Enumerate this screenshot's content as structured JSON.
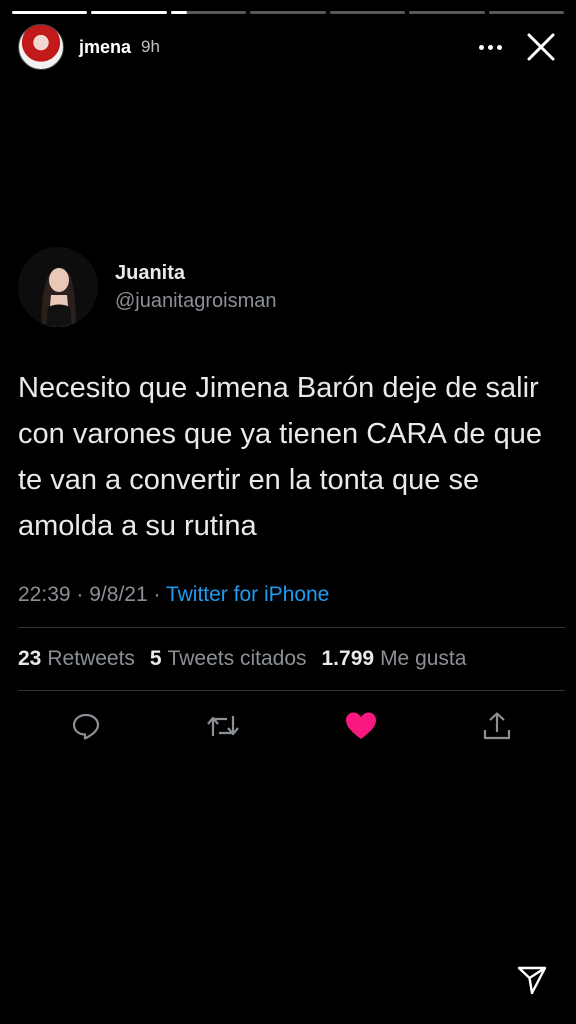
{
  "story": {
    "segments": [
      "done",
      "done",
      "current",
      "pending",
      "pending",
      "pending",
      "pending"
    ],
    "username": "jmena",
    "time": "9h",
    "icons": {
      "more": "more-dots-icon",
      "close": "close-icon",
      "send": "send-icon"
    }
  },
  "tweet": {
    "name": "Juanita",
    "handle": "@juanitagroisman",
    "text": "Necesito que Jimena Barón deje de salir con varones que ya tienen CARA de que te van a convertir en la tonta que se amolda a su rutina",
    "time": "22:39",
    "date": "9/8/21",
    "separator": "·",
    "source": "Twitter for iPhone",
    "stats": {
      "retweets_count": "23",
      "retweets_label": "Retweets",
      "quotes_count": "5",
      "quotes_label": "Tweets citados",
      "likes_count": "1.799",
      "likes_label": "Me gusta"
    },
    "actions": [
      "reply-icon",
      "retweet-icon",
      "like-heart-icon",
      "share-icon"
    ],
    "colors": {
      "link": "#1d9bf0",
      "like": "#f91880",
      "muted": "#8b9096"
    }
  }
}
